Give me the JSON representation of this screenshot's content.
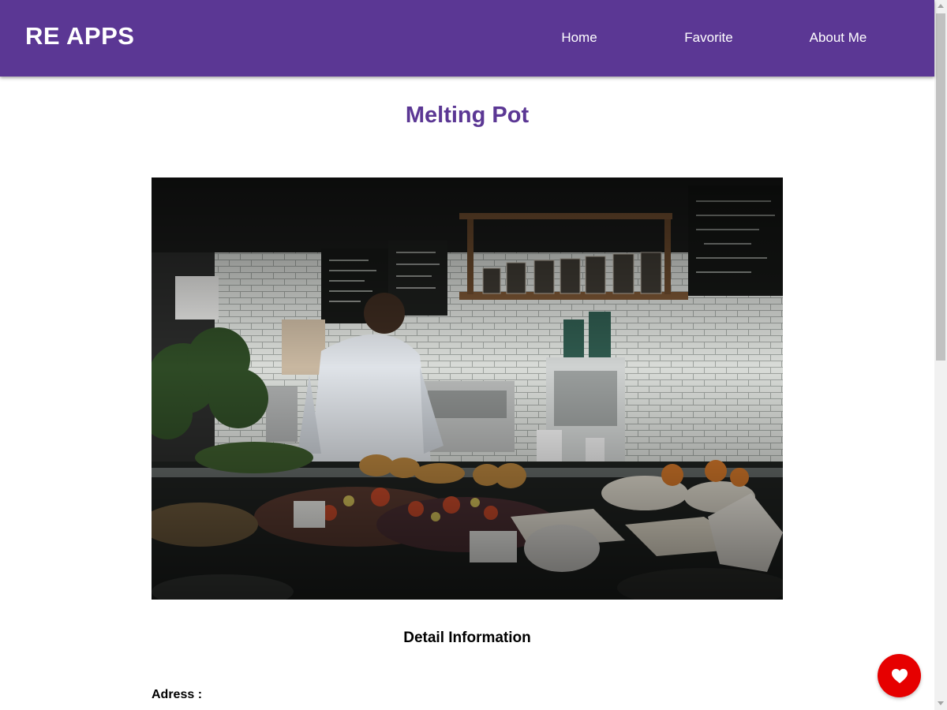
{
  "header": {
    "brand": "RE APPS",
    "nav": [
      {
        "label": "Home"
      },
      {
        "label": "Favorite"
      },
      {
        "label": "About Me"
      }
    ]
  },
  "restaurant": {
    "name": "Melting Pot",
    "image_alt": "Melting Pot"
  },
  "detail": {
    "heading": "Detail Information",
    "address_label": "Adress :"
  },
  "favorite_button": {
    "icon": "heart-icon",
    "aria_label": "favorite"
  },
  "colors": {
    "header_bg": "#5b3794",
    "title": "#5b3794",
    "fab": "#e60000"
  }
}
